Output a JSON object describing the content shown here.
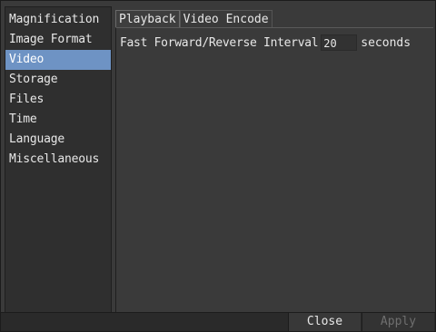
{
  "sidebar": {
    "items": [
      {
        "label": "Magnification"
      },
      {
        "label": "Image Format"
      },
      {
        "label": "Video"
      },
      {
        "label": "Storage"
      },
      {
        "label": "Files"
      },
      {
        "label": "Time"
      },
      {
        "label": "Language"
      },
      {
        "label": "Miscellaneous"
      }
    ],
    "selected_index": 2,
    "selected_color": "#6e93c4"
  },
  "tabs": [
    {
      "label": "Playback"
    },
    {
      "label": "Video Encode"
    }
  ],
  "playback": {
    "interval_label": "Fast Forward/Reverse Interval",
    "interval_value": "20",
    "interval_unit": "seconds"
  },
  "footer": {
    "close_label": "Close",
    "apply_label": "Apply"
  }
}
